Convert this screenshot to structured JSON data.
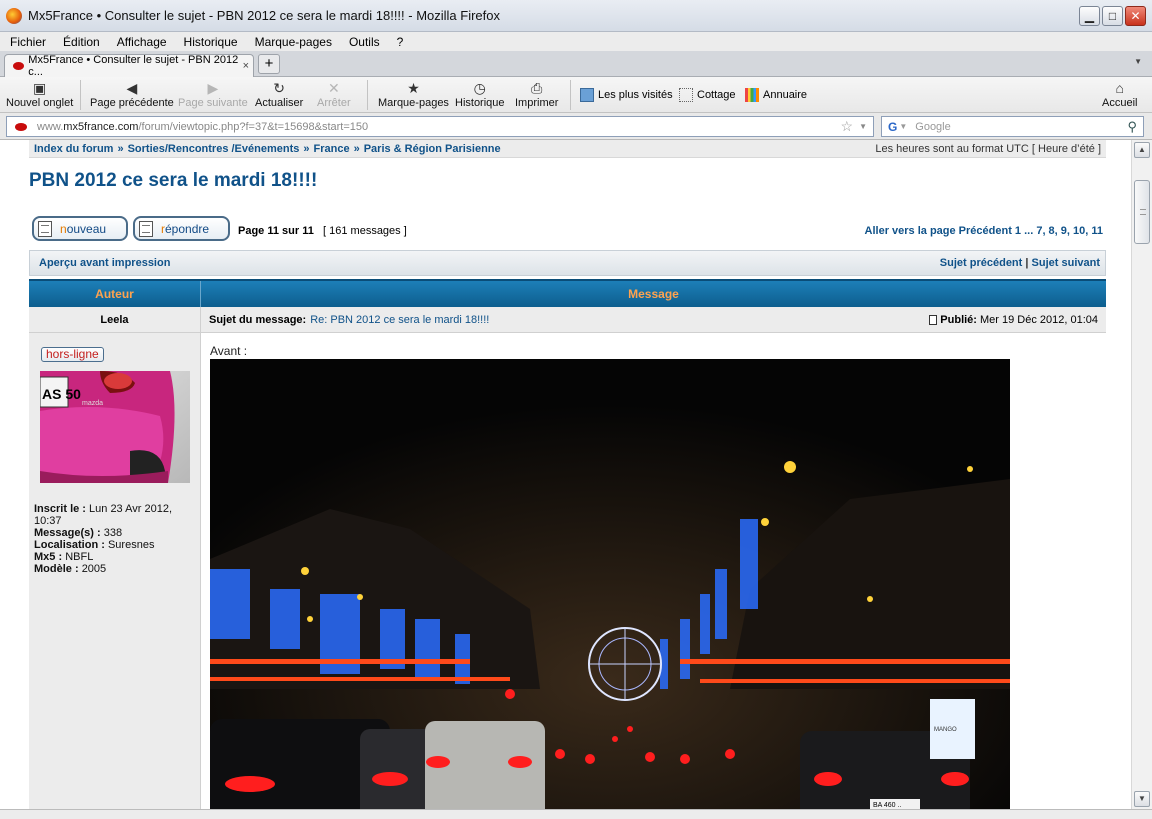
{
  "window": {
    "title": "Mx5France • Consulter le sujet - PBN 2012 ce sera le mardi 18!!!! - Mozilla Firefox"
  },
  "menu": [
    "Fichier",
    "Édition",
    "Affichage",
    "Historique",
    "Marque-pages",
    "Outils",
    "?"
  ],
  "tab": {
    "title": "Mx5France • Consulter le sujet - PBN 2012 c...",
    "close": "×",
    "new_tab": "+"
  },
  "toolbar": {
    "new_tab": "Nouvel onglet",
    "back": "Page précédente",
    "forward": "Page suivante",
    "reload": "Actualiser",
    "stop": "Arrêter",
    "bookmarks": "Marque-pages",
    "history": "Historique",
    "print": "Imprimer",
    "most_visited": "Les plus visités",
    "cottage": "Cottage",
    "annuaire": "Annuaire",
    "home": "Accueil"
  },
  "url": {
    "prefix": "www.",
    "domain": "mx5france.com",
    "path": "/forum/viewtopic.php?f=37&t=15698&start=150"
  },
  "search": {
    "placeholder": "Google"
  },
  "forum": {
    "breadcrumb": [
      "Index du forum",
      "Sorties/Rencontres /Evénements",
      "France",
      "Paris & Région Parisienne"
    ],
    "breadcrumb_sep": "»",
    "timezone": "Les heures sont au format UTC [ Heure d’été ]",
    "topic_title": "PBN 2012 ce sera le mardi 18!!!!",
    "btn_new_first": "n",
    "btn_new_rest": "ouveau",
    "btn_reply_first": "r",
    "btn_reply_rest": "épondre",
    "page_info": "Page 11 sur 11",
    "message_count": "[ 161 messages ]",
    "pagination": "Aller vers la page Précédent  1 ... 7, 8, 9, 10, 11",
    "print_view": "Aperçu avant impression",
    "prev_topic": "Sujet précédent",
    "next_topic": "Sujet suivant",
    "nav_sep": "|",
    "col_author": "Auteur",
    "col_message": "Message"
  },
  "post": {
    "author": "Leela",
    "subject_label": "Sujet du message:",
    "subject": "Re: PBN 2012 ce sera le mardi 18!!!!",
    "published_label": "Publié:",
    "published": "Mer 19 Déc 2012, 01:04",
    "status": "hors-ligne",
    "joined_label": "Inscrit le :",
    "joined": "Lun 23 Avr 2012, 10:37",
    "messages_label": "Message(s) :",
    "messages": "338",
    "location_label": "Localisation :",
    "location": "Suresnes",
    "mx5_label": "Mx5 :",
    "mx5": "NBFL",
    "model_label": "Modèle :",
    "model": "2005",
    "body_text": "Avant :",
    "plate_text": "AS 50",
    "avatar_brand": "mazda",
    "photo_plate": "BA 460 ..",
    "sign_text": "MANGO"
  }
}
